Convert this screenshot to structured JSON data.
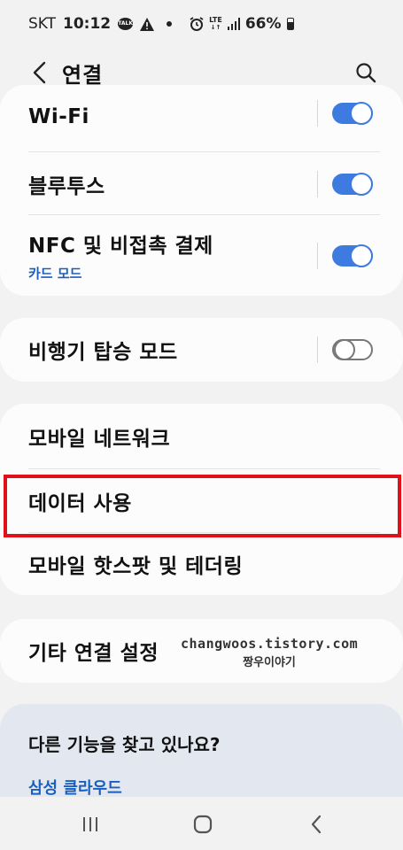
{
  "status_bar": {
    "carrier": "SKT",
    "time": "10:12",
    "network": "LTE",
    "battery": "66%",
    "icons": [
      "talk-icon",
      "warning-icon",
      "dot-icon",
      "alarm-icon",
      "lte-icon",
      "signal-icon",
      "battery-icon"
    ]
  },
  "header": {
    "title": "연결",
    "back_icon": "chevron-left-icon",
    "search_icon": "search-icon"
  },
  "group1": {
    "items": [
      {
        "label": "Wi-Fi",
        "toggle": true
      },
      {
        "label": "블루투스",
        "toggle": true
      },
      {
        "label": "NFC 및 비접촉 결제",
        "sub": "카드 모드",
        "toggle": true
      }
    ]
  },
  "group2": {
    "items": [
      {
        "label": "비행기 탑승 모드",
        "toggle": false
      }
    ]
  },
  "group3": {
    "items": [
      {
        "label": "모바일 네트워크"
      },
      {
        "label": "데이터 사용"
      },
      {
        "label": "모바일 핫스팟 및 테더링"
      }
    ]
  },
  "group4": {
    "items": [
      {
        "label": "기타 연결 설정"
      }
    ]
  },
  "watermark": {
    "url": "changwoos.tistory.com",
    "name": "짱우이야기"
  },
  "suggestions": {
    "title": "다른 기능을 찾고 있나요?",
    "link": "삼성 클라우드"
  },
  "nav_bar": {
    "icons": [
      "recent-apps-icon",
      "home-icon",
      "back-icon"
    ]
  },
  "colors": {
    "toggle_on": "#3e7be0",
    "link": "#1a5fbd",
    "highlight": "#e0111a",
    "suggest_bg": "#e3e8f0"
  }
}
